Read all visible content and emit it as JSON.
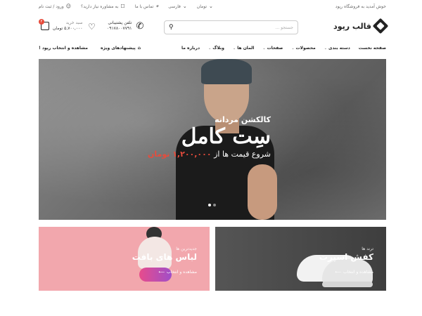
{
  "topbar": {
    "welcome": "خوش آمدید به فروشگاه رپود",
    "links": [
      {
        "label": "ورود / ثبت نام",
        "icon": "user-icon"
      },
      {
        "label": "به مشاوره نیاز دارید؟",
        "icon": "chat-icon"
      },
      {
        "label": "تماس با ما",
        "icon": "location-icon"
      },
      {
        "label": "فارسی",
        "icon": "chevron-down-icon"
      },
      {
        "label": "تومان",
        "icon": "chevron-down-icon"
      }
    ]
  },
  "header": {
    "logo": "قالب رپود",
    "search_placeholder": "جستجو ...",
    "phone_label": "تلفن پشتیبانی",
    "phone_number": "۰۹۱۷۸۰۰۷۷۹۱",
    "cart_label": "سبد خرید",
    "cart_total": "۵,۷۰۰,۰۰۰ تومان",
    "cart_count": "۴"
  },
  "nav": {
    "items": [
      "صفحه نخست",
      "دسته بندی",
      "محصولات",
      "صفحات",
      "المان ها",
      "وبلاگ",
      "درباره ما"
    ],
    "has_caret": [
      false,
      true,
      true,
      true,
      true,
      true,
      false
    ],
    "special_offers": "پیشنهادهای ویژه",
    "browse": "مشاهده و انتخاب رپود !"
  },
  "hero": {
    "subtitle": "کالکشن مردانه",
    "title": "سِت کامل",
    "price_prefix": "شروع قیمت ها از",
    "price_value": "۱,۲۰۰,۰۰۰ تومان",
    "slides": 2,
    "active_slide": 0
  },
  "banners": [
    {
      "small": "ترند ها",
      "big": "کفش اسپرت",
      "link": "مشاهده و انتخاب"
    },
    {
      "small": "جدیدترین ها",
      "big": "لباس های بافت",
      "link": "مشاهده و انتخاب"
    }
  ]
}
